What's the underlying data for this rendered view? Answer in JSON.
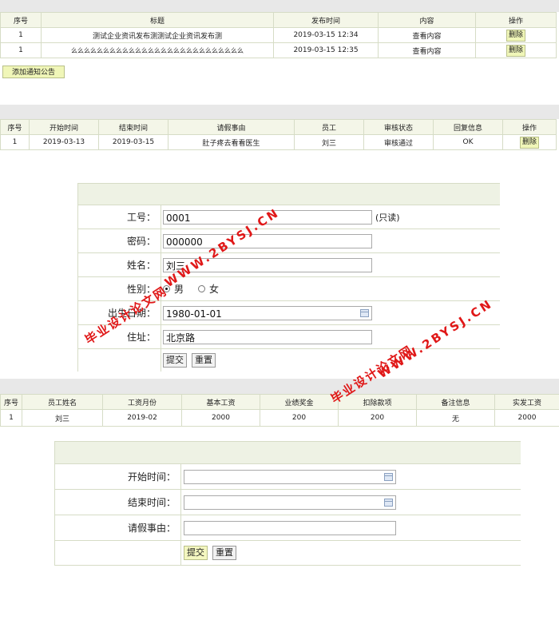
{
  "notice_table": {
    "headers": [
      "序号",
      "标题",
      "发布时间",
      "内容",
      "操作"
    ],
    "rows": [
      {
        "no": "1",
        "title": "测试企业资讯发布测测试企业资讯发布测",
        "time": "2019-03-15 12:34",
        "content": "查看内容",
        "action": "删除"
      },
      {
        "no": "1",
        "title": "么么么么么么么么么么么么么么么么么么么么么么么么么么么",
        "time": "2019-03-15 12:35",
        "content": "查看内容",
        "action": "删除"
      }
    ],
    "add_button": "添加通知公告"
  },
  "leave_table": {
    "headers": [
      "序号",
      "开始时间",
      "结束时间",
      "请假事由",
      "员工",
      "审核状态",
      "回复信息",
      "操作"
    ],
    "rows": [
      {
        "no": "1",
        "start": "2019-03-13",
        "end": "2019-03-15",
        "reason": "肚子疼去看看医生",
        "employee": "刘三",
        "status": "审核通过",
        "reply": "OK",
        "action": "删除"
      }
    ]
  },
  "employee_form": {
    "id_label": "工号：",
    "id_value": "0001",
    "id_note": "(只读)",
    "pwd_label": "密码：",
    "pwd_value": "000000",
    "name_label": "姓名：",
    "name_value": "刘三",
    "gender_label": "性别：",
    "male": "男",
    "female": "女",
    "birth_label": "出生日期：",
    "birth_value": "1980-01-01",
    "addr_label": "住址：",
    "addr_value": "北京路",
    "submit": "提交",
    "reset": "重置"
  },
  "salary_table": {
    "headers": [
      "序号",
      "员工姓名",
      "工资月份",
      "基本工资",
      "业绩奖金",
      "扣除款项",
      "备注信息",
      "实发工资"
    ],
    "rows": [
      {
        "no": "1",
        "name": "刘三",
        "month": "2019-02",
        "base": "2000",
        "bonus": "200",
        "deduct": "200",
        "note": "无",
        "actual": "2000"
      }
    ]
  },
  "leave_form": {
    "start_label": "开始时间：",
    "end_label": "结束时间：",
    "reason_label": "请假事由：",
    "submit": "提交",
    "reset": "重置"
  },
  "watermark": {
    "url_text": "WWW.2BYSJ.CN",
    "site_text": "毕业设计论文网",
    "color": "#e01818"
  }
}
